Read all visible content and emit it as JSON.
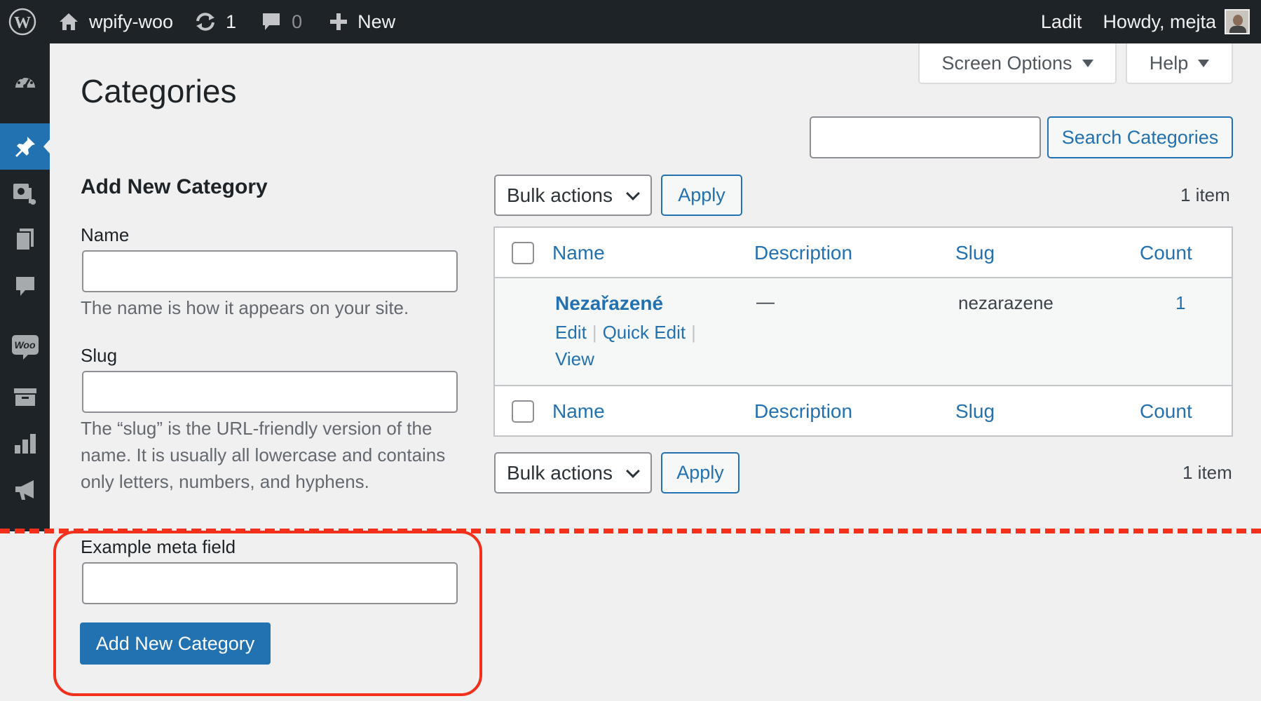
{
  "adminbar": {
    "site_name": "wpify-woo",
    "updates_count": "1",
    "comments_count": "0",
    "new_label": "New",
    "lang_label": "Ladit",
    "greeting": "Howdy, mejta"
  },
  "header": {
    "title": "Categories",
    "screen_options_label": "Screen Options",
    "help_label": "Help",
    "search_button_label": "Search Categories",
    "search_value": ""
  },
  "form": {
    "title": "Add New Category",
    "name_label": "Name",
    "name_value": "",
    "name_help": "The name is how it appears on your site.",
    "slug_label": "Slug",
    "slug_value": "",
    "slug_help": "The “slug” is the URL-friendly version of the name. It is usually all lowercase and contains only letters, numbers, and hyphens.",
    "meta_label": "Example meta field",
    "meta_value": "",
    "submit_label": "Add New Category"
  },
  "list": {
    "bulk_actions_label": "Bulk actions",
    "apply_label": "Apply",
    "item_count": "1 item",
    "columns": [
      "Name",
      "Description",
      "Slug",
      "Count"
    ],
    "rows": [
      {
        "name": "Nezařazené",
        "description": "—",
        "slug": "nezarazene",
        "count": "1",
        "actions": [
          "Edit",
          "Quick Edit",
          "View"
        ]
      }
    ]
  },
  "colors": {
    "accent": "#2271b1",
    "adminbar_bg": "#1d2327",
    "highlight": "#f2301c"
  },
  "icons": {
    "sidebar": [
      "dashboard-icon",
      "posts-pin-icon",
      "media-icon",
      "pages-icon",
      "comments-icon",
      "woocommerce-icon",
      "products-icon",
      "analytics-icon",
      "marketing-icon"
    ]
  }
}
